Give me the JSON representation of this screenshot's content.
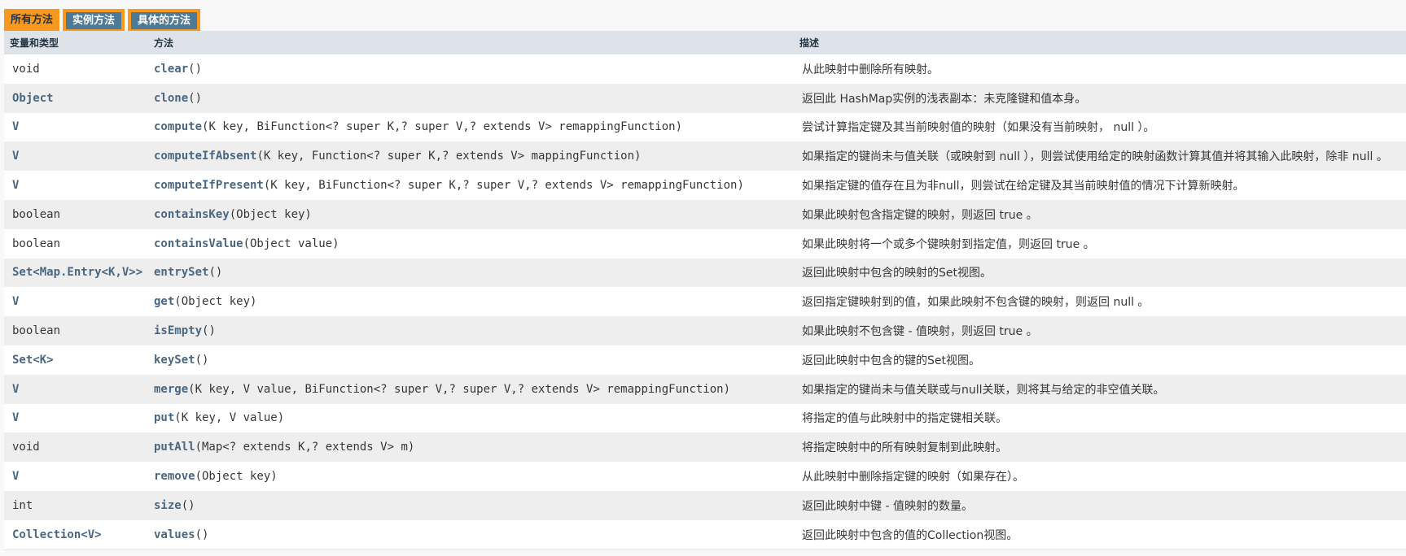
{
  "tabs": [
    {
      "label": "所有方法",
      "active": true
    },
    {
      "label": "实例方法",
      "active": false
    },
    {
      "label": "具体的方法",
      "active": false
    }
  ],
  "headers": {
    "type": "变量和类型",
    "method": "方法",
    "description": "描述"
  },
  "colors": {
    "accent_orange": "#f8981d",
    "tab_blue": "#4d7a97",
    "header_bg": "#dee3e9",
    "link": "#4a6782",
    "text": "#353833"
  },
  "rows": [
    {
      "type": "void",
      "type_link": false,
      "method": "clear()",
      "description": "从此映射中删除所有映射。"
    },
    {
      "type": "Object",
      "type_link": true,
      "method": "clone()",
      "description": "返回此 HashMap实例的浅表副本：未克隆键和值本身。"
    },
    {
      "type": "V",
      "type_link": true,
      "method": "compute(K key, BiFunction<? super K,? super V,? extends V> remappingFunction)",
      "description": "尝试计算指定键及其当前映射值的映射（如果没有当前映射， null ）。"
    },
    {
      "type": "V",
      "type_link": true,
      "method": "computeIfAbsent(K key, Function<? super K,? extends V> mappingFunction)",
      "description": "如果指定的键尚未与值关联（或映射到 null ），则尝试使用给定的映射函数计算其值并将其输入此映射，除非 null 。"
    },
    {
      "type": "V",
      "type_link": true,
      "method": "computeIfPresent(K key, BiFunction<? super K,? super V,? extends V> remappingFunction)",
      "description": "如果指定键的值存在且为非null，则尝试在给定键及其当前映射值的情况下计算新映射。"
    },
    {
      "type": "boolean",
      "type_link": false,
      "method": "containsKey(Object key)",
      "description": "如果此映射包含指定键的映射，则返回 true 。"
    },
    {
      "type": "boolean",
      "type_link": false,
      "method": "containsValue(Object value)",
      "description": "如果此映射将一个或多个键映射到指定值，则返回 true 。"
    },
    {
      "type": "Set<Map.Entry<K,V>>",
      "type_link": true,
      "method": "entrySet()",
      "description": "返回此映射中包含的映射的Set视图。"
    },
    {
      "type": "V",
      "type_link": true,
      "method": "get(Object key)",
      "description": "返回指定键映射到的值，如果此映射不包含键的映射，则返回 null 。"
    },
    {
      "type": "boolean",
      "type_link": false,
      "method": "isEmpty()",
      "description": "如果此映射不包含键 - 值映射，则返回 true 。"
    },
    {
      "type": "Set<K>",
      "type_link": true,
      "method": "keySet()",
      "description": "返回此映射中包含的键的Set视图。"
    },
    {
      "type": "V",
      "type_link": true,
      "method": "merge(K key, V value, BiFunction<? super V,? super V,? extends V> remappingFunction)",
      "description": "如果指定的键尚未与值关联或与null关联，则将其与给定的非空值关联。"
    },
    {
      "type": "V",
      "type_link": true,
      "method": "put(K key, V value)",
      "description": "将指定的值与此映射中的指定键相关联。"
    },
    {
      "type": "void",
      "type_link": false,
      "method": "putAll(Map<? extends K,? extends V> m)",
      "description": "将指定映射中的所有映射复制到此映射。"
    },
    {
      "type": "V",
      "type_link": true,
      "method": "remove(Object key)",
      "description": "从此映射中删除指定键的映射（如果存在）。"
    },
    {
      "type": "int",
      "type_link": false,
      "method": "size()",
      "description": "返回此映射中键 - 值映射的数量。"
    },
    {
      "type": "Collection<V>",
      "type_link": true,
      "method": "values()",
      "description": "返回此映射中包含的值的Collection视图。"
    }
  ]
}
